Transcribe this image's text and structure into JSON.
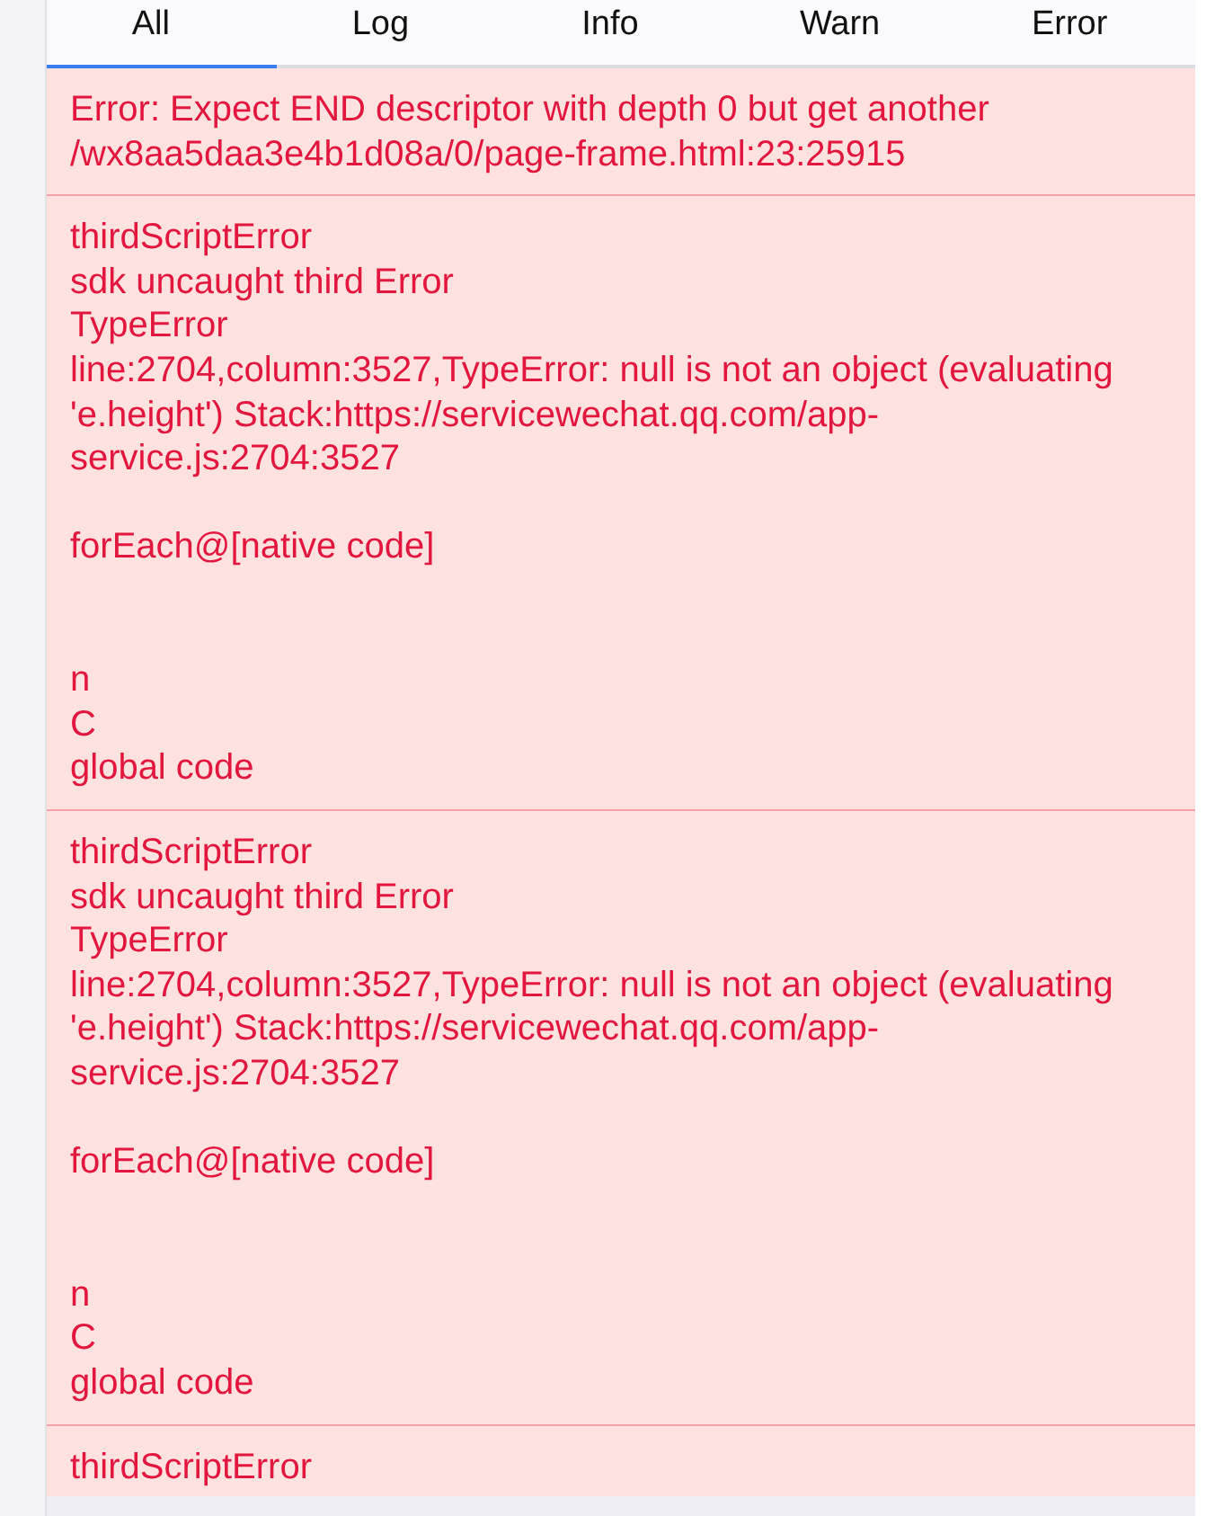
{
  "tabs": [
    {
      "label": "All",
      "selected": true
    },
    {
      "label": "Log",
      "selected": false
    },
    {
      "label": "Info",
      "selected": false
    },
    {
      "label": "Warn",
      "selected": false
    },
    {
      "label": "Error",
      "selected": false
    }
  ],
  "entries": [
    {
      "kind": "error",
      "text": "Error: Expect END descriptor with depth 0 but get another /wx8aa5daa3e4b1d08a/0/page-frame.html:23:25915"
    },
    {
      "kind": "error",
      "text": "thirdScriptError\nsdk uncaught third Error\nTypeError\nline:2704,column:3527,TypeError: null is not an object (evaluating 'e.height') Stack:https://servicewechat.qq.com/app-service.js:2704:3527\n\nforEach@[native code]\n\n\nn\nC\nglobal code"
    },
    {
      "kind": "error",
      "text": "thirdScriptError\nsdk uncaught third Error\nTypeError\nline:2704,column:3527,TypeError: null is not an object (evaluating 'e.height') Stack:https://servicewechat.qq.com/app-service.js:2704:3527\n\nforEach@[native code]\n\n\nn\nC\nglobal code"
    },
    {
      "kind": "error",
      "text": "thirdScriptError"
    }
  ]
}
